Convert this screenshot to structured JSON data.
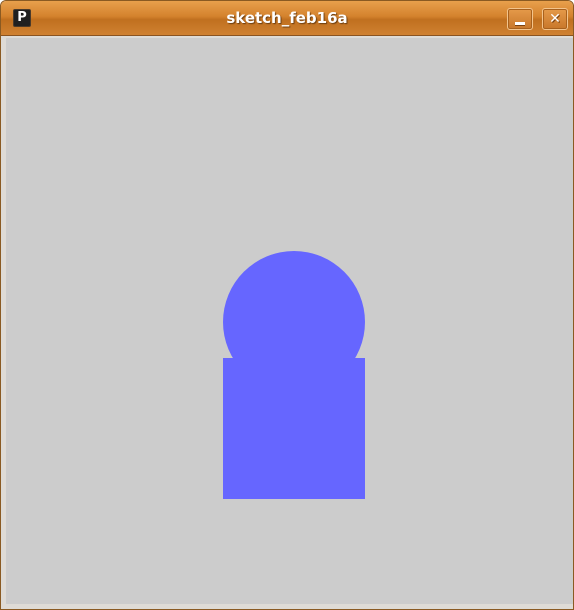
{
  "window": {
    "title": "sketch_feb16a",
    "app_icon_glyph": "P"
  },
  "canvas": {
    "background_color": "#cccccc",
    "shapes": [
      {
        "kind": "circle",
        "name": "sketch-circle",
        "fill": "#6666ff"
      },
      {
        "kind": "rect",
        "name": "sketch-rectangle",
        "fill": "#6666ff"
      }
    ]
  },
  "colors": {
    "titlebar_accent": "#d4822d",
    "shape_fill": "#6666ff",
    "canvas_bg": "#cccccc"
  }
}
